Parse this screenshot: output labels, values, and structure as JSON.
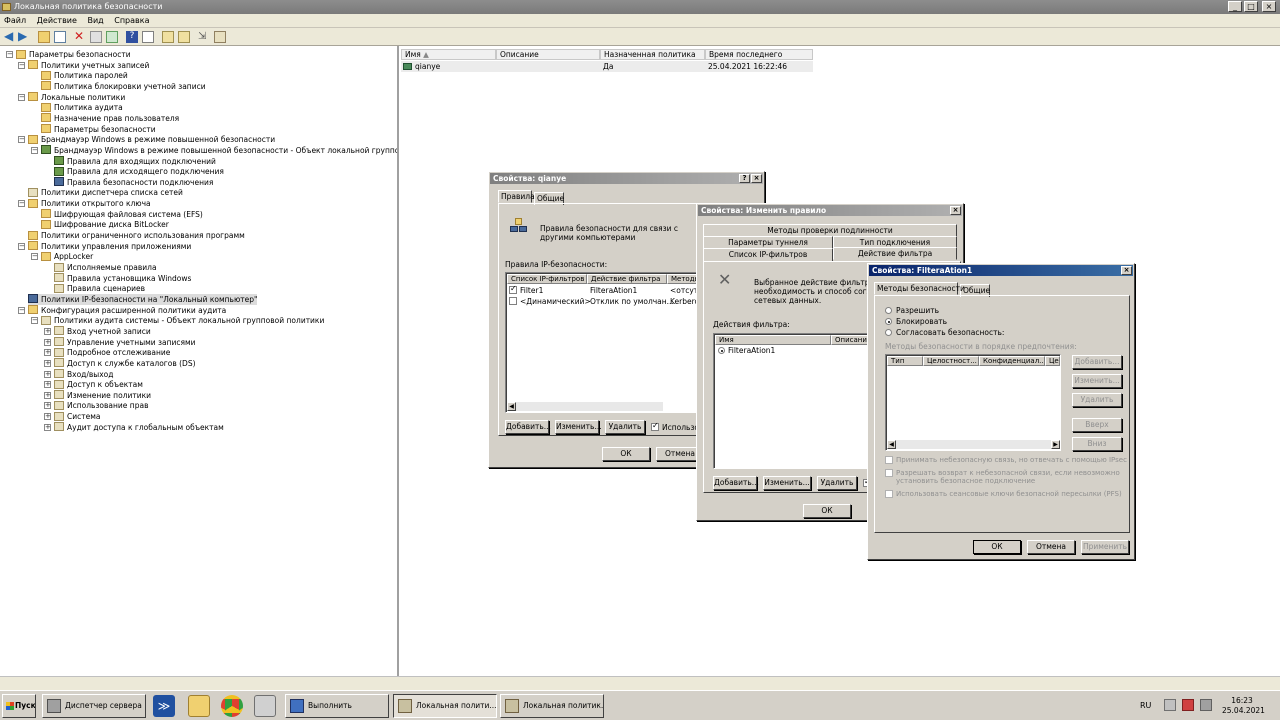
{
  "window": {
    "title": "Локальная политика безопасности"
  },
  "menu": [
    "Файл",
    "Действие",
    "Вид",
    "Справка"
  ],
  "tree": [
    {
      "label": "Параметры безопасности",
      "indent": 0,
      "icon": "fold",
      "exp": "−"
    },
    {
      "label": "Политики учетных записей",
      "indent": 1,
      "icon": "fold",
      "exp": "−"
    },
    {
      "label": "Политика паролей",
      "indent": 2,
      "icon": "fold",
      "exp": ""
    },
    {
      "label": "Политика блокировки учетной записи",
      "indent": 2,
      "icon": "fold",
      "exp": ""
    },
    {
      "label": "Локальные политики",
      "indent": 1,
      "icon": "fold",
      "exp": "−"
    },
    {
      "label": "Политика аудита",
      "indent": 2,
      "icon": "fold",
      "exp": ""
    },
    {
      "label": "Назначение прав пользователя",
      "indent": 2,
      "icon": "fold",
      "exp": ""
    },
    {
      "label": "Параметры безопасности",
      "indent": 2,
      "icon": "fold",
      "exp": ""
    },
    {
      "label": "Брандмауэр Windows в режиме повышенной безопасности",
      "indent": 1,
      "icon": "fold",
      "exp": "−"
    },
    {
      "label": "Брандмауэр Windows в режиме повышенной безопасности - Объект локальной групповой политики",
      "indent": 2,
      "icon": "fw",
      "exp": "−"
    },
    {
      "label": "Правила для входящих подключений",
      "indent": 3,
      "icon": "fw",
      "exp": ""
    },
    {
      "label": "Правила для исходящего подключения",
      "indent": 3,
      "icon": "fw",
      "exp": ""
    },
    {
      "label": "Правила безопасности подключения",
      "indent": 3,
      "icon": "net",
      "exp": ""
    },
    {
      "label": "Политики диспетчера списка сетей",
      "indent": 1,
      "icon": "pol",
      "exp": ""
    },
    {
      "label": "Политики открытого ключа",
      "indent": 1,
      "icon": "fold",
      "exp": "−"
    },
    {
      "label": "Шифрующая файловая система (EFS)",
      "indent": 2,
      "icon": "fold",
      "exp": ""
    },
    {
      "label": "Шифрование диска BitLocker",
      "indent": 2,
      "icon": "fold",
      "exp": ""
    },
    {
      "label": "Политики ограниченного использования программ",
      "indent": 1,
      "icon": "fold",
      "exp": ""
    },
    {
      "label": "Политики управления приложениями",
      "indent": 1,
      "icon": "fold",
      "exp": "−"
    },
    {
      "label": "AppLocker",
      "indent": 2,
      "icon": "fold",
      "exp": "−"
    },
    {
      "label": "Исполняемые правила",
      "indent": 3,
      "icon": "pol",
      "exp": ""
    },
    {
      "label": "Правила установщика Windows",
      "indent": 3,
      "icon": "pol",
      "exp": ""
    },
    {
      "label": "Правила сценариев",
      "indent": 3,
      "icon": "pol",
      "exp": ""
    },
    {
      "label": "Политики IP-безопасности на \"Локальный компьютер\"",
      "indent": 1,
      "icon": "net",
      "exp": "",
      "selected": true
    },
    {
      "label": "Конфигурация расширенной политики аудита",
      "indent": 1,
      "icon": "fold",
      "exp": "−"
    },
    {
      "label": "Политики аудита системы - Объект локальной групповой политики",
      "indent": 2,
      "icon": "pol",
      "exp": "−"
    },
    {
      "label": "Вход учетной записи",
      "indent": 3,
      "icon": "pol",
      "exp": "+"
    },
    {
      "label": "Управление учетными записями",
      "indent": 3,
      "icon": "pol",
      "exp": "+"
    },
    {
      "label": "Подробное отслеживание",
      "indent": 3,
      "icon": "pol",
      "exp": "+"
    },
    {
      "label": "Доступ к службе каталогов (DS)",
      "indent": 3,
      "icon": "pol",
      "exp": "+"
    },
    {
      "label": "Вход/выход",
      "indent": 3,
      "icon": "pol",
      "exp": "+"
    },
    {
      "label": "Доступ к объектам",
      "indent": 3,
      "icon": "pol",
      "exp": "+"
    },
    {
      "label": "Изменение политики",
      "indent": 3,
      "icon": "pol",
      "exp": "+"
    },
    {
      "label": "Использование прав",
      "indent": 3,
      "icon": "pol",
      "exp": "+"
    },
    {
      "label": "Система",
      "indent": 3,
      "icon": "pol",
      "exp": "+"
    },
    {
      "label": "Аудит доступа к глобальным объектам",
      "indent": 3,
      "icon": "pol",
      "exp": "+"
    }
  ],
  "list": {
    "headers": [
      "Имя",
      "Описание",
      "Назначенная политика",
      "Время последнего изменения"
    ],
    "rows": [
      [
        "qianye",
        "",
        "Да",
        "25.04.2021 16:22:46"
      ]
    ]
  },
  "dlg1": {
    "title": "Свойства: qianye",
    "tabs": [
      "Правила",
      "Общие"
    ],
    "desc": "Правила безопасности для связи с другими компьютерами",
    "group_label": "Правила IP-безопасности:",
    "headers": [
      "Список IP-фильтров",
      "Действие фильтра",
      "Методы"
    ],
    "rows": [
      [
        "Filter1",
        "FilteraAtion1",
        "<отсутст"
      ],
      [
        "<Динамический>",
        "Отклик по умолчан...",
        "Kerberos"
      ]
    ],
    "buttons": [
      "Добавить...",
      "Изменить...",
      "Удалить"
    ],
    "use_label": "Использо",
    "ok": "ОК",
    "cancel": "Отмена"
  },
  "dlg2": {
    "title": "Свойства: Изменить правило",
    "tabs_row1": [
      "Методы проверки подлинности"
    ],
    "tabs_row2": [
      "Параметры туннеля",
      "Тип подключения"
    ],
    "tabs_row3": [
      "Список IP-фильтров",
      "Действие фильтра"
    ],
    "desc_lines": [
      "Выбранное действие фильтра оп",
      "необходимость и способ согласо",
      "сетевых данных."
    ],
    "group_label": "Действия фильтра:",
    "headers": [
      "Имя",
      "Описание"
    ],
    "rows": [
      "FilteraAtion1"
    ],
    "buttons": [
      "Добавить...",
      "Изменить...",
      "Удалить"
    ],
    "ok": "ОК"
  },
  "dlg3": {
    "title": "Свойства: FilteraAtion1",
    "tabs": [
      "Методы безопасности",
      "Общие"
    ],
    "radios": [
      "Разрешить",
      "Блокировать",
      "Согласовать безопасность:"
    ],
    "order_label": "Методы безопасности в порядке предпочтения:",
    "headers": [
      "Тип",
      "Целостност...",
      "Конфиденциал...",
      "Це"
    ],
    "side_buttons": [
      "Добавить...",
      "Изменить...",
      "Удалить",
      "Вверх",
      "Вниз"
    ],
    "checks": [
      "Принимать небезопасную связь, но отвечать с помощью IPsec",
      "Разрешать возврат к небезопасной связи, если невозможно",
      "установить безопасное подключение",
      "Использовать сеансовые ключи безопасной пересылки (PFS)"
    ],
    "ok": "ОК",
    "cancel": "Отмена",
    "apply": "Применить"
  },
  "taskbar": {
    "start": "Пуск",
    "items": [
      "Диспетчер сервера",
      "Выполнить",
      "Локальная полити...",
      "Локальная политик..."
    ],
    "lang": "RU",
    "time": "16:23",
    "date": "25.04.2021"
  }
}
